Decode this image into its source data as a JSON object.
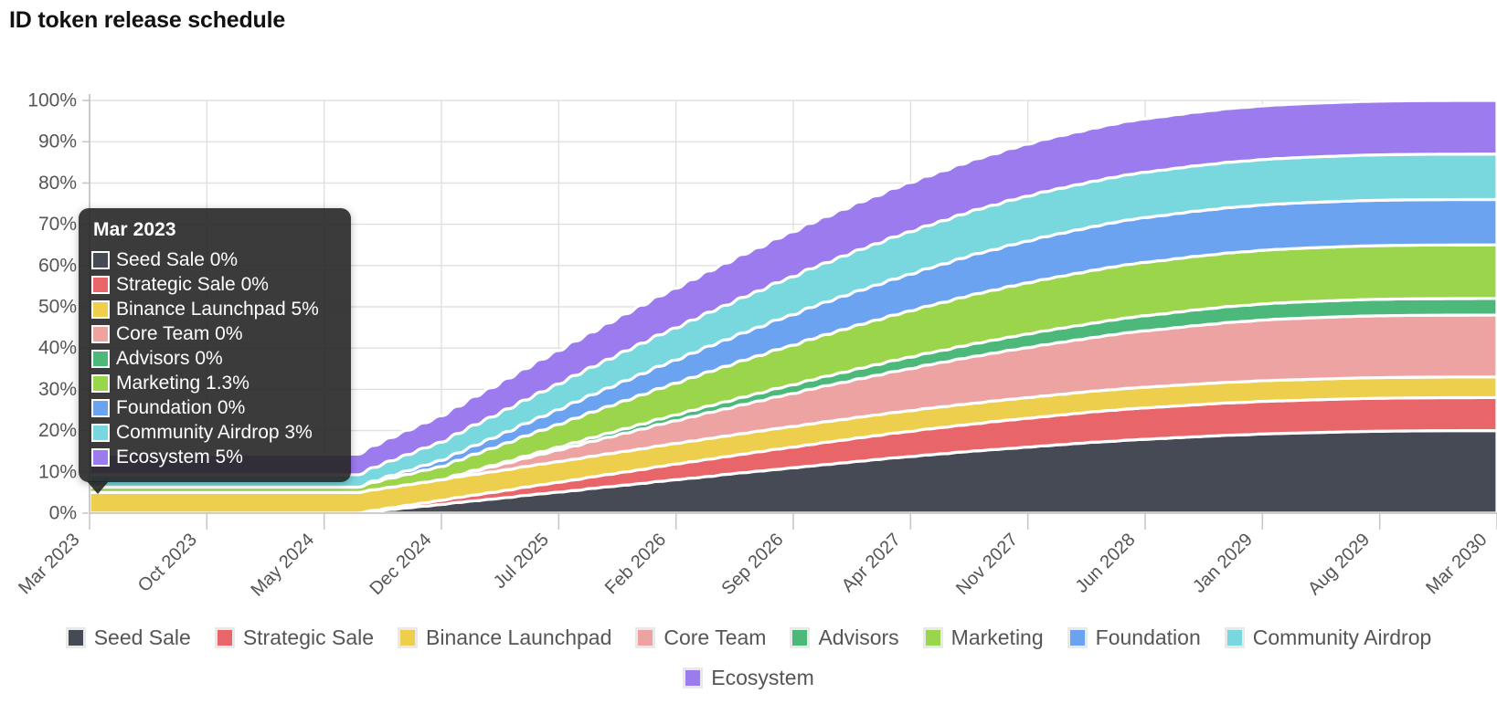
{
  "title": "ID token release schedule",
  "chart_data": {
    "type": "area",
    "stacked": true,
    "stack_mode": "percent",
    "title": "ID token release schedule",
    "xlabel": "",
    "ylabel": "",
    "ylim": [
      0,
      100
    ],
    "ytick_labels": [
      "0%",
      "10%",
      "20%",
      "30%",
      "40%",
      "50%",
      "60%",
      "70%",
      "80%",
      "90%",
      "100%"
    ],
    "ytick_values": [
      0,
      10,
      20,
      30,
      40,
      50,
      60,
      70,
      80,
      90,
      100
    ],
    "xtick_labels": [
      "Mar 2023",
      "Oct 2023",
      "May 2024",
      "Dec 2024",
      "Jul 2025",
      "Feb 2026",
      "Sep 2026",
      "Apr 2027",
      "Nov 2027",
      "Jun 2028",
      "Jan 2029",
      "Aug 2029",
      "Mar 2030"
    ],
    "xtick_rotation": -45,
    "grid": true,
    "legend_position": "bottom",
    "x_start": "Mar 2023",
    "x_end": "Mar 2030",
    "n_points": 85,
    "series": [
      {
        "name": "Seed Sale",
        "color": "#454a54",
        "final_value": 20.0,
        "values": [
          0,
          0,
          0,
          0,
          0,
          0,
          0,
          0,
          0,
          0,
          0,
          0,
          0,
          0,
          0,
          0,
          0,
          0.5,
          0.9,
          1.3,
          1.7,
          2.1,
          2.6,
          3.0,
          3.4,
          3.8,
          4.3,
          4.7,
          5.1,
          5.5,
          6.0,
          6.4,
          6.8,
          7.2,
          7.7,
          8.1,
          8.5,
          8.9,
          9.4,
          9.8,
          10.2,
          10.6,
          11.0,
          11.4,
          11.8,
          12.2,
          12.6,
          13.0,
          13.4,
          13.7,
          14.1,
          14.4,
          14.8,
          15.1,
          15.4,
          15.7,
          16.0,
          16.3,
          16.6,
          16.9,
          17.2,
          17.4,
          17.7,
          17.9,
          18.1,
          18.3,
          18.5,
          18.7,
          18.9,
          19.0,
          19.2,
          19.3,
          19.4,
          19.5,
          19.6,
          19.7,
          19.8,
          19.85,
          19.9,
          19.93,
          19.96,
          19.98,
          19.99,
          20.0,
          20.0
        ]
      },
      {
        "name": "Strategic Sale",
        "color": "#e8666a",
        "final_value": 8.0,
        "values": [
          0,
          0,
          0,
          0,
          0,
          0,
          0,
          0,
          0,
          0,
          0,
          0,
          0,
          0,
          0,
          0,
          0,
          0.2,
          0.4,
          0.6,
          0.8,
          1.0,
          1.2,
          1.4,
          1.6,
          1.8,
          2.0,
          2.2,
          2.4,
          2.6,
          2.8,
          3.0,
          3.2,
          3.4,
          3.6,
          3.8,
          4.0,
          4.2,
          4.3,
          4.5,
          4.7,
          4.9,
          5.0,
          5.2,
          5.4,
          5.5,
          5.7,
          5.8,
          6.0,
          6.1,
          6.3,
          6.4,
          6.5,
          6.6,
          6.8,
          6.9,
          7.0,
          7.1,
          7.2,
          7.3,
          7.4,
          7.5,
          7.55,
          7.6,
          7.65,
          7.7,
          7.75,
          7.8,
          7.83,
          7.86,
          7.89,
          7.91,
          7.93,
          7.95,
          7.96,
          7.97,
          7.98,
          7.99,
          7.99,
          8.0,
          8.0,
          8.0,
          8.0,
          8.0,
          8.0
        ]
      },
      {
        "name": "Binance Launchpad",
        "color": "#edce4d",
        "final_value": 5.0,
        "values": [
          5.0,
          5.0,
          5.0,
          5.0,
          5.0,
          5.0,
          5.0,
          5.0,
          5.0,
          5.0,
          5.0,
          5.0,
          5.0,
          5.0,
          5.0,
          5.0,
          5.0,
          5.0,
          5.0,
          5.0,
          5.0,
          5.0,
          5.0,
          5.0,
          5.0,
          5.0,
          5.0,
          5.0,
          5.0,
          5.0,
          5.0,
          5.0,
          5.0,
          5.0,
          5.0,
          5.0,
          5.0,
          5.0,
          5.0,
          5.0,
          5.0,
          5.0,
          5.0,
          5.0,
          5.0,
          5.0,
          5.0,
          5.0,
          5.0,
          5.0,
          5.0,
          5.0,
          5.0,
          5.0,
          5.0,
          5.0,
          5.0,
          5.0,
          5.0,
          5.0,
          5.0,
          5.0,
          5.0,
          5.0,
          5.0,
          5.0,
          5.0,
          5.0,
          5.0,
          5.0,
          5.0,
          5.0,
          5.0,
          5.0,
          5.0,
          5.0,
          5.0,
          5.0,
          5.0,
          5.0,
          5.0,
          5.0,
          5.0,
          5.0,
          5.0
        ]
      },
      {
        "name": "Core Team",
        "color": "#eea3a3",
        "final_value": 15.0,
        "values": [
          0,
          0,
          0,
          0,
          0,
          0,
          0,
          0,
          0,
          0,
          0,
          0,
          0,
          0,
          0,
          0,
          0,
          0,
          0,
          0,
          0,
          0,
          0.4,
          0.8,
          1.2,
          1.6,
          2.0,
          2.4,
          2.8,
          3.2,
          3.6,
          4.0,
          4.4,
          4.8,
          5.2,
          5.5,
          5.9,
          6.3,
          6.6,
          7.0,
          7.3,
          7.7,
          8.0,
          8.4,
          8.7,
          9.0,
          9.3,
          9.6,
          9.9,
          10.2,
          10.5,
          10.8,
          11.1,
          11.4,
          11.6,
          11.9,
          12.1,
          12.4,
          12.6,
          12.8,
          13.0,
          13.3,
          13.5,
          13.7,
          13.8,
          14.0,
          14.2,
          14.3,
          14.5,
          14.6,
          14.7,
          14.8,
          14.85,
          14.9,
          14.93,
          14.96,
          14.98,
          14.99,
          15.0,
          15.0,
          15.0,
          15.0,
          15.0,
          15.0,
          15.0
        ]
      },
      {
        "name": "Advisors",
        "color": "#4cb97b",
        "final_value": 4.0,
        "values": [
          0,
          0,
          0,
          0,
          0,
          0,
          0,
          0,
          0,
          0,
          0,
          0,
          0,
          0,
          0,
          0,
          0,
          0,
          0,
          0,
          0,
          0,
          0.1,
          0.2,
          0.3,
          0.4,
          0.5,
          0.6,
          0.7,
          0.8,
          0.9,
          1.0,
          1.1,
          1.2,
          1.3,
          1.4,
          1.5,
          1.6,
          1.7,
          1.8,
          1.9,
          2.0,
          2.1,
          2.2,
          2.3,
          2.4,
          2.5,
          2.6,
          2.7,
          2.8,
          2.85,
          2.9,
          3.0,
          3.1,
          3.15,
          3.2,
          3.3,
          3.35,
          3.4,
          3.45,
          3.5,
          3.55,
          3.6,
          3.65,
          3.7,
          3.75,
          3.8,
          3.82,
          3.85,
          3.88,
          3.9,
          3.92,
          3.94,
          3.95,
          3.96,
          3.97,
          3.98,
          3.99,
          4.0,
          4.0,
          4.0,
          4.0,
          4.0,
          4.0,
          4.0
        ]
      },
      {
        "name": "Marketing",
        "color": "#9ad54b",
        "final_value": 13.0,
        "values": [
          1.3,
          1.3,
          1.3,
          1.3,
          1.3,
          1.3,
          1.3,
          1.3,
          1.3,
          1.3,
          1.3,
          1.3,
          1.3,
          1.3,
          1.3,
          1.3,
          1.3,
          1.8,
          2.2,
          2.5,
          2.9,
          3.2,
          3.5,
          3.9,
          4.2,
          4.5,
          4.9,
          5.2,
          5.5,
          5.9,
          6.2,
          6.5,
          6.8,
          7.1,
          7.4,
          7.7,
          8.0,
          8.3,
          8.6,
          8.9,
          9.1,
          9.4,
          9.6,
          9.9,
          10.1,
          10.4,
          10.6,
          10.8,
          11.0,
          11.2,
          11.4,
          11.6,
          11.8,
          12.0,
          12.1,
          12.3,
          12.4,
          12.5,
          12.6,
          12.7,
          12.8,
          12.85,
          12.9,
          12.92,
          12.94,
          12.96,
          12.97,
          12.98,
          12.99,
          13.0,
          13.0,
          13.0,
          13.0,
          13.0,
          13.0,
          13.0,
          13.0,
          13.0,
          13.0,
          13.0,
          13.0,
          13.0,
          13.0,
          13.0,
          13.0
        ]
      },
      {
        "name": "Foundation",
        "color": "#6ba3f0",
        "final_value": 11.0,
        "values": [
          0,
          0,
          0,
          0,
          0,
          0,
          0,
          0,
          0,
          0,
          0,
          0,
          0,
          0,
          0,
          0,
          0,
          0.3,
          0.6,
          0.9,
          1.2,
          1.5,
          1.8,
          2.1,
          2.4,
          2.7,
          3.0,
          3.3,
          3.6,
          3.9,
          4.2,
          4.5,
          4.8,
          5.1,
          5.4,
          5.6,
          5.9,
          6.2,
          6.4,
          6.7,
          6.9,
          7.2,
          7.4,
          7.7,
          7.9,
          8.1,
          8.3,
          8.5,
          8.7,
          8.9,
          9.1,
          9.3,
          9.5,
          9.7,
          9.8,
          10.0,
          10.1,
          10.3,
          10.4,
          10.5,
          10.6,
          10.7,
          10.8,
          10.85,
          10.9,
          10.92,
          10.94,
          10.96,
          10.97,
          10.98,
          10.99,
          11.0,
          11.0,
          11.0,
          11.0,
          11.0,
          11.0,
          11.0,
          11.0,
          11.0,
          11.0,
          11.0,
          11.0,
          11.0,
          11.0
        ]
      },
      {
        "name": "Community Airdrop",
        "color": "#78d8dd",
        "final_value": 11.0,
        "values": [
          3.0,
          3.0,
          3.0,
          3.0,
          3.0,
          3.0,
          3.0,
          3.0,
          3.0,
          3.0,
          3.0,
          3.0,
          3.0,
          3.0,
          3.0,
          3.0,
          3.0,
          3.3,
          3.6,
          3.9,
          4.2,
          4.4,
          4.7,
          5.0,
          5.2,
          5.5,
          5.7,
          6.0,
          6.2,
          6.5,
          6.7,
          6.9,
          7.2,
          7.4,
          7.6,
          7.8,
          8.0,
          8.2,
          8.4,
          8.6,
          8.8,
          9.0,
          9.2,
          9.4,
          9.5,
          9.7,
          9.9,
          10.0,
          10.2,
          10.3,
          10.4,
          10.5,
          10.6,
          10.7,
          10.8,
          10.85,
          10.9,
          10.92,
          10.94,
          10.95,
          10.96,
          10.97,
          10.98,
          10.99,
          11.0,
          11.0,
          11.0,
          11.0,
          11.0,
          11.0,
          11.0,
          11.0,
          11.0,
          11.0,
          11.0,
          11.0,
          11.0,
          11.0,
          11.0,
          11.0,
          11.0,
          11.0,
          11.0,
          11.0,
          11.0
        ]
      },
      {
        "name": "Ecosystem",
        "color": "#9c7bef",
        "final_value": 13.0,
        "values": [
          5.0,
          5.0,
          5.0,
          5.0,
          5.0,
          5.0,
          5.0,
          5.0,
          5.0,
          5.0,
          5.0,
          5.0,
          5.0,
          5.0,
          5.0,
          5.0,
          5.0,
          5.3,
          5.6,
          5.9,
          6.1,
          6.4,
          6.6,
          6.9,
          7.1,
          7.4,
          7.6,
          7.9,
          8.1,
          8.3,
          8.5,
          8.8,
          9.0,
          9.2,
          9.4,
          9.6,
          9.8,
          10.0,
          10.2,
          10.4,
          10.5,
          10.7,
          10.9,
          11.0,
          11.2,
          11.3,
          11.5,
          11.6,
          11.8,
          11.9,
          12.0,
          12.1,
          12.2,
          12.3,
          12.4,
          12.5,
          12.6,
          12.7,
          12.75,
          12.8,
          12.85,
          12.9,
          12.92,
          12.94,
          12.96,
          12.97,
          12.98,
          12.99,
          13.0,
          13.0,
          13.0,
          13.0,
          13.0,
          13.0,
          13.0,
          13.0,
          13.0,
          13.0,
          13.0,
          13.0,
          13.0,
          13.0,
          13.0,
          13.0,
          13.0
        ]
      }
    ]
  },
  "tooltip": {
    "date": "Mar 2023",
    "rows": [
      {
        "label": "Seed Sale 0%",
        "color": "#454a54"
      },
      {
        "label": "Strategic Sale 0%",
        "color": "#e8666a"
      },
      {
        "label": "Binance Launchpad 5%",
        "color": "#edce4d"
      },
      {
        "label": "Core Team 0%",
        "color": "#eea3a3"
      },
      {
        "label": "Advisors 0%",
        "color": "#4cb97b"
      },
      {
        "label": "Marketing 1.3%",
        "color": "#9ad54b"
      },
      {
        "label": "Foundation 0%",
        "color": "#6ba3f0"
      },
      {
        "label": "Community Airdrop 3%",
        "color": "#78d8dd"
      },
      {
        "label": "Ecosystem 5%",
        "color": "#9c7bef"
      }
    ]
  },
  "legend": {
    "row1": [
      {
        "label": "Seed Sale",
        "color": "#454a54"
      },
      {
        "label": "Strategic Sale",
        "color": "#e8666a"
      },
      {
        "label": "Binance Launchpad",
        "color": "#edce4d"
      },
      {
        "label": "Core Team",
        "color": "#eea3a3"
      },
      {
        "label": "Advisors",
        "color": "#4cb97b"
      },
      {
        "label": "Marketing",
        "color": "#9ad54b"
      },
      {
        "label": "Foundation",
        "color": "#6ba3f0"
      },
      {
        "label": "Community Airdrop",
        "color": "#78d8dd"
      }
    ],
    "row2": [
      {
        "label": "Ecosystem",
        "color": "#9c7bef"
      }
    ]
  }
}
